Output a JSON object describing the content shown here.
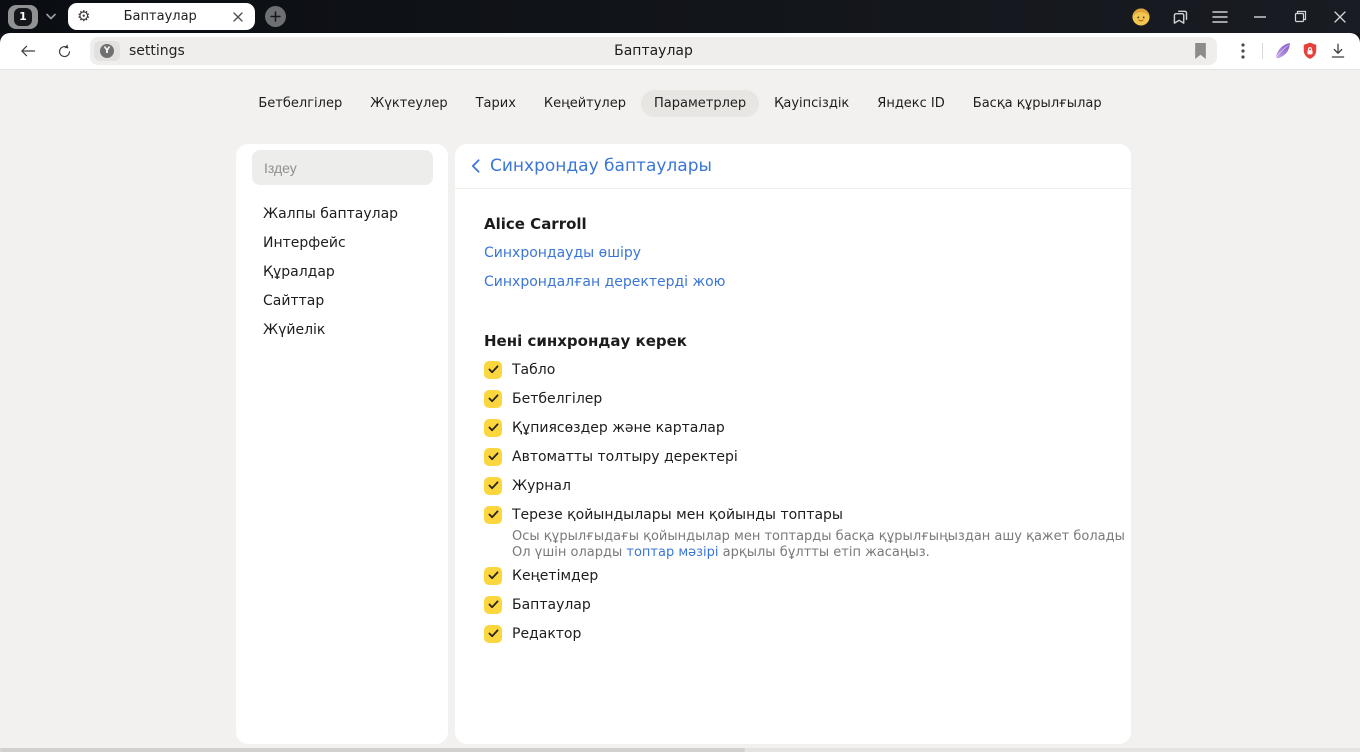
{
  "titlebar": {
    "tab_count": "1",
    "tab_title": "Баптаулар"
  },
  "toolbar": {
    "address": "settings",
    "page_title": "Баптаулар"
  },
  "nav": {
    "items": [
      {
        "label": "Бетбелгілер",
        "selected": false
      },
      {
        "label": "Жүктеулер",
        "selected": false
      },
      {
        "label": "Тарих",
        "selected": false
      },
      {
        "label": "Кеңейтулер",
        "selected": false
      },
      {
        "label": "Параметрлер",
        "selected": true
      },
      {
        "label": "Қауіпсіздік",
        "selected": false
      },
      {
        "label": "Яндекс ID",
        "selected": false
      },
      {
        "label": "Басқа құрылғылар",
        "selected": false
      }
    ]
  },
  "sidebar": {
    "search_placeholder": "Іздеу",
    "items": [
      {
        "label": "Жалпы баптаулар"
      },
      {
        "label": "Интерфейс"
      },
      {
        "label": "Құралдар"
      },
      {
        "label": "Сайттар"
      },
      {
        "label": "Жүйелік"
      }
    ]
  },
  "content": {
    "header": "Синхрондау баптаулары",
    "account_name": "Alice Carroll",
    "links": {
      "disable_sync": "Синхрондауды өшіру",
      "delete_synced": "Синхрондалған деректерді жою"
    },
    "section_title": "Нені синхрондау керек",
    "checkboxes": [
      {
        "label": "Табло",
        "checked": true
      },
      {
        "label": "Бетбелгілер",
        "checked": true
      },
      {
        "label": "Құпиясөздер және карталар",
        "checked": true
      },
      {
        "label": "Автоматты толтыру деректері",
        "checked": true
      },
      {
        "label": "Журнал",
        "checked": true
      },
      {
        "label": "Терезе қойындылары мен қойынды топтары",
        "checked": true,
        "description": {
          "line1": "Осы құрылғыдағы қойындылар мен топтарды басқа құрылғыңыздан ашу қажет болады",
          "line2_prefix": "Ол үшін оларды ",
          "line2_link": "топтар мәзірі",
          "line2_suffix": " арқылы бұлтты етіп жасаңыз."
        }
      },
      {
        "label": "Кеңетімдер",
        "checked": true
      },
      {
        "label": "Баптаулар",
        "checked": true
      },
      {
        "label": "Редактор",
        "checked": true
      }
    ]
  },
  "colors": {
    "accent_blue": "#3b76d6",
    "checkbox_yellow": "#fcd63e",
    "shield_red": "#e6403a",
    "feather_purple": "#8f5fd0"
  }
}
